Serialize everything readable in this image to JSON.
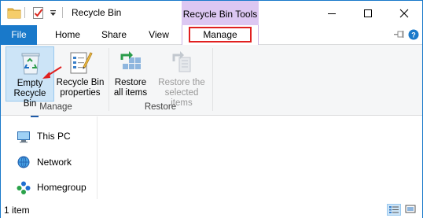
{
  "window": {
    "title": "Recycle Bin",
    "contextual_tab_group": "Recycle Bin Tools"
  },
  "tabs": {
    "file": "File",
    "home": "Home",
    "share": "Share",
    "view": "View",
    "manage": "Manage"
  },
  "ribbon": {
    "manage_group": {
      "label": "Manage",
      "empty_recycle_bin": [
        "Empty",
        "Recycle Bin"
      ],
      "recycle_bin_properties": [
        "Recycle Bin",
        "properties"
      ]
    },
    "restore_group": {
      "label": "Restore",
      "restore_all_items": [
        "Restore",
        "all items"
      ],
      "restore_selected_items": [
        "Restore the",
        "selected items"
      ]
    }
  },
  "nav_pane": {
    "items": [
      {
        "label": "This PC",
        "icon": "computer-icon"
      },
      {
        "label": "Network",
        "icon": "network-icon"
      },
      {
        "label": "Homegroup",
        "icon": "homegroup-icon"
      }
    ]
  },
  "status_bar": {
    "item_count": "1 item"
  },
  "colors": {
    "accent": "#1979ca",
    "contextual_tab": "#dcc7f2",
    "highlight_box": "#e02020",
    "selected_button": "#cce4f7"
  }
}
